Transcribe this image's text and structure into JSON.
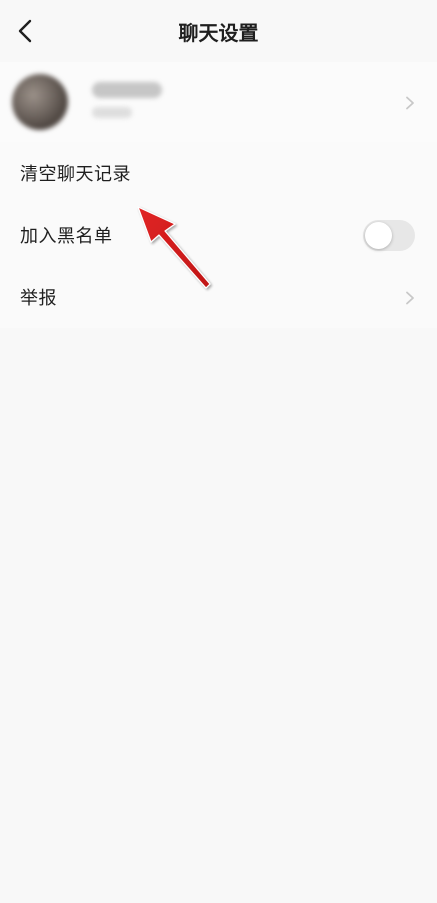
{
  "header": {
    "title": "聊天设置"
  },
  "profile": {
    "name": "",
    "subtitle": ""
  },
  "rows": [
    {
      "label": "清空聊天记录"
    },
    {
      "label": "加入黑名单",
      "toggle_on": false
    },
    {
      "label": "举报"
    }
  ],
  "icons": {
    "back": "chevron-left-icon",
    "chevron": "chevron-right-icon"
  },
  "colors": {
    "background": "#f8f8f8",
    "text": "#1f1f1f",
    "chevron": "#c8c8c8",
    "toggle_off": "#e7e7e7",
    "annotation_arrow": "#e12424"
  }
}
